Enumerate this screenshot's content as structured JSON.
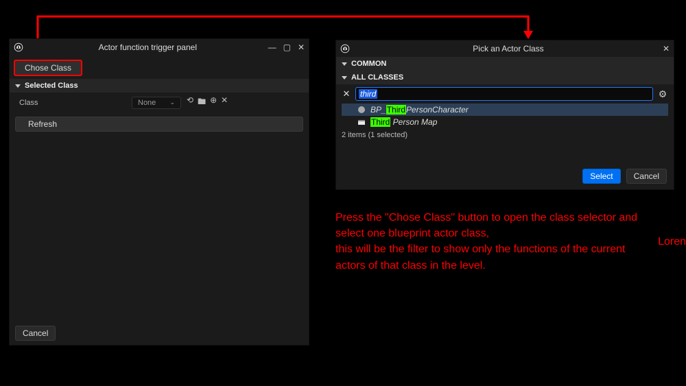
{
  "left": {
    "title": "Actor function trigger panel",
    "chose_class": "Chose Class",
    "selected_class_header": "Selected Class",
    "class_label": "Class",
    "class_value": "None",
    "refresh": "Refresh",
    "cancel": "Cancel"
  },
  "picker": {
    "title": "Pick an Actor Class",
    "common_header": "COMMON",
    "all_classes_header": "ALL CLASSES",
    "search_value": "third",
    "search_highlight": "Third",
    "results": [
      {
        "prefix": "BP_",
        "match": "Third",
        "suffix": "PersonCharacter"
      },
      {
        "prefix": "",
        "match": "Third",
        "suffix": " Person Map"
      }
    ],
    "items_count": "2 items (1 selected)",
    "select": "Select",
    "cancel": "Cancel"
  },
  "instruction": "Press the \"Chose Class\" button to open the class selector and select one blueprint actor class,\n this will be the filter to show only the functions of the current actors of that class in the level.",
  "loren": "Loren"
}
